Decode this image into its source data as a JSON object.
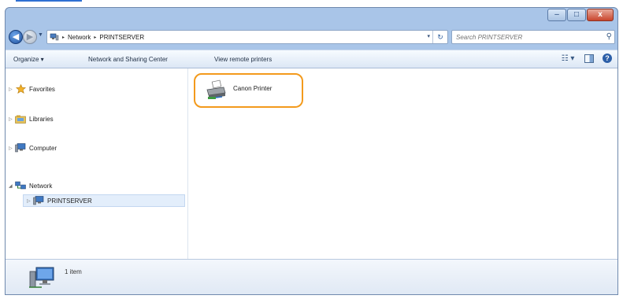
{
  "window": {
    "controls": {
      "minimize": "–",
      "maximize": "□",
      "close": "x"
    }
  },
  "address_bar": {
    "segments": [
      "Network",
      "PRINTSERVER"
    ],
    "separator": "▸",
    "dropdown": "▾",
    "refresh": "↻"
  },
  "search": {
    "placeholder": "Search PRINTSERVER",
    "icon": "magnifier"
  },
  "toolbar": {
    "organize_label": "Organize ▾",
    "network_sharing_label": "Network and Sharing Center",
    "remote_printers_label": "View remote printers",
    "view_options": "☷ ▾",
    "help": "?"
  },
  "nav_pane": {
    "favorites": "Favorites",
    "libraries": "Libraries",
    "computer": "Computer",
    "network": "Network",
    "server": "PRINTSERVER"
  },
  "files": {
    "printer_name": "Canon Printer"
  },
  "status": {
    "item_count": "1 item"
  },
  "colors": {
    "highlight_border": "#f39a1c",
    "window_frame": "#a9c5e8",
    "selection": "#e3eefb"
  }
}
